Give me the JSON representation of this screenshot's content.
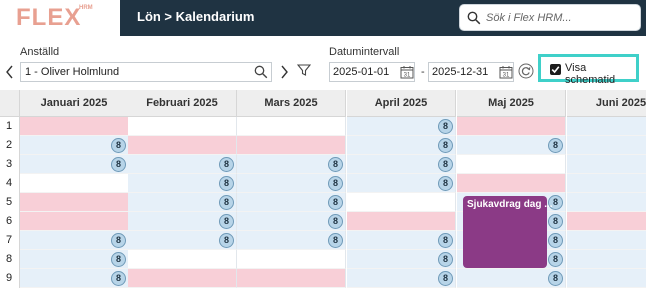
{
  "header": {
    "logo_text": "FLEX",
    "logo_sub": "HRM",
    "breadcrumb": "Lön > Kalendarium",
    "search_placeholder": "Sök i Flex HRM..."
  },
  "filters": {
    "employee_label": "Anställd",
    "employee_value": "1 - Oliver Holmlund",
    "date_label": "Datumintervall",
    "date_from": "2025-01-01",
    "date_to": "2025-12-31",
    "date_separator": "-",
    "show_schedule_label": "Visa schematid",
    "show_schedule_checked": true
  },
  "calendar": {
    "months": [
      "Januari 2025",
      "Februari 2025",
      "Mars 2025",
      "April 2025",
      "Maj 2025",
      "Juni 2025"
    ],
    "rows": [
      "1",
      "2",
      "3",
      "4",
      "5",
      "6",
      "7",
      "8",
      "9"
    ],
    "event": {
      "title": "Sjukavdrag dag ..."
    },
    "badge_value": "8",
    "colors": {
      "weekday": "#e6f0f9",
      "holiday": "#f8cfd7",
      "empty": "#ffffff",
      "event": "#8b3a86",
      "brand": "#e8a091",
      "topbar": "#1f3342",
      "highlight": "#3fd0c9"
    }
  }
}
